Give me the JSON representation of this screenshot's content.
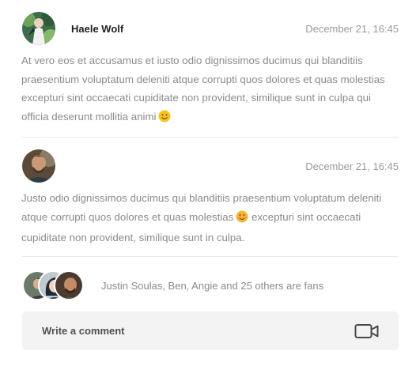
{
  "comments": [
    {
      "author": "Haele Wolf",
      "date": "December 21, 16:45",
      "text": "At vero eos et accusamus et iusto odio dignissimos ducimus qui blanditiis praesentium voluptatum deleniti atque corrupti quos dolores et quas molestias excepturi sint occaecati cupiditate non provident, similique sunt in culpa qui officia deserunt mollitia animi",
      "avatar_icon": "user-avatar"
    },
    {
      "author": "",
      "date": "December 21, 16:45",
      "text_before": "Justo odio dignissimos ducimus qui blanditiis praesentium voluptatum deleniti atque corrupti quos dolores et quas molestias",
      "text_after": "excepturi sint occaecati cupiditate non provident, similique sunt in culpa.",
      "avatar_icon": "user-avatar"
    }
  ],
  "fans": {
    "text": "Justin Soulas, Ben, Angie and 25 others are fans"
  },
  "composer": {
    "placeholder": "Write a comment",
    "video_icon": "video-camera-icon"
  },
  "colors": {
    "text": "#8b8b8b",
    "author": "#1e1e1e",
    "composer_bg": "#f3f3f3",
    "divider": "#e9e9e9",
    "emoji": "#f5c518"
  }
}
